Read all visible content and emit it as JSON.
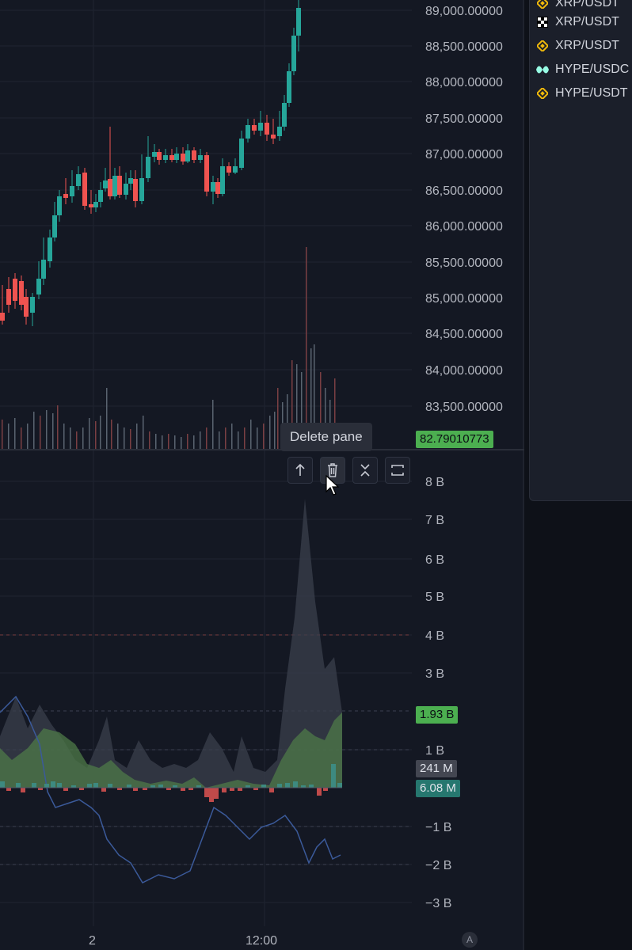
{
  "colors": {
    "bg": "#141823",
    "up": "#26a69a",
    "down": "#ef5350",
    "grid": "#1f2430",
    "text": "#b2b5be",
    "badge_green": "#4caf50",
    "badge_teal": "#26776f",
    "badge_grey": "#434651"
  },
  "price_axis": {
    "labels": [
      "89,000.00000",
      "88,500.00000",
      "88,000.00000",
      "87,500.00000",
      "87,000.00000",
      "86,500.00000",
      "86,000.00000",
      "85,500.00000",
      "85,000.00000",
      "84,500.00000",
      "84,000.00000",
      "83,500.00000"
    ]
  },
  "price_badge": "82.79010773",
  "tooltip": "Delete pane",
  "pane_toolbar": {
    "icons": [
      "arrow-up-icon",
      "trash-icon",
      "collapse-icon",
      "maximize-icon"
    ]
  },
  "indicator_axis": {
    "labels": [
      "8 B",
      "7 B",
      "6 B",
      "5 B",
      "4 B",
      "3 B",
      "1 B",
      "−1 B",
      "−2 B",
      "−3 B"
    ]
  },
  "indicator_badges": {
    "green": "1.93 B",
    "grey": "241 M",
    "teal": "6.08 M"
  },
  "time_axis": {
    "labels": [
      "2",
      "12:00"
    ],
    "auto_label": "A"
  },
  "watchlist": {
    "items": [
      {
        "symbol": "XRP/USDT",
        "icon": "binance-icon"
      },
      {
        "symbol": "XRP/USDT",
        "icon": "okx-icon"
      },
      {
        "symbol": "XRP/USDT",
        "icon": "binance-icon"
      },
      {
        "symbol": "HYPE/USDC",
        "icon": "hyperliquid-icon"
      },
      {
        "symbol": "HYPE/USDT",
        "icon": "binance-icon"
      }
    ]
  }
}
